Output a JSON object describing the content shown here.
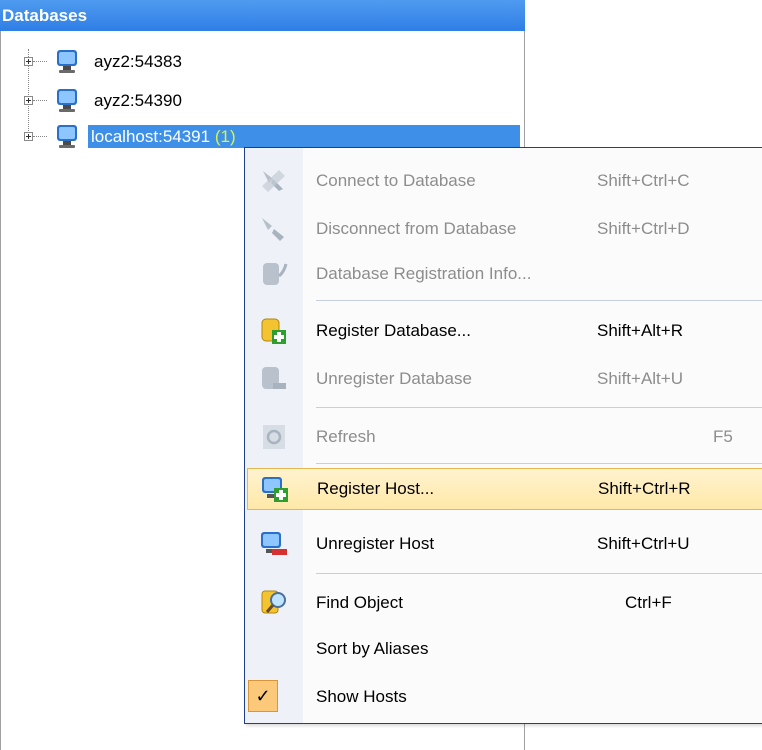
{
  "panel": {
    "title": "Databases",
    "hosts": [
      {
        "label": "ayz2:54383",
        "count": ""
      },
      {
        "label": "ayz2:54390",
        "count": ""
      },
      {
        "label": "localhost:54391",
        "count": "(1)"
      }
    ]
  },
  "menu": {
    "items": [
      {
        "label": "Connect to Database",
        "shortcut": "Shift+Ctrl+C",
        "icon": "connect-icon",
        "enabled": false
      },
      {
        "label": "Disconnect from Database",
        "shortcut": "Shift+Ctrl+D",
        "icon": "disconnect-icon",
        "enabled": false
      },
      {
        "label": "Database Registration Info...",
        "shortcut": "",
        "icon": "database-info-icon",
        "enabled": false
      },
      {
        "label": "Register Database...",
        "shortcut": "Shift+Alt+R",
        "icon": "register-database-icon",
        "enabled": true
      },
      {
        "label": "Unregister Database",
        "shortcut": "Shift+Alt+U",
        "icon": "unregister-database-icon",
        "enabled": false
      },
      {
        "label": "Refresh",
        "shortcut": "F5",
        "icon": "refresh-icon",
        "enabled": false
      },
      {
        "label": "Register Host...",
        "shortcut": "Shift+Ctrl+R",
        "icon": "register-host-icon",
        "enabled": true
      },
      {
        "label": "Unregister Host",
        "shortcut": "Shift+Ctrl+U",
        "icon": "unregister-host-icon",
        "enabled": true
      },
      {
        "label": "Find Object",
        "shortcut": "Ctrl+F",
        "icon": "find-object-icon",
        "enabled": true
      },
      {
        "label": "Sort by Aliases",
        "shortcut": "",
        "icon": "",
        "enabled": true
      },
      {
        "label": "Show Hosts",
        "shortcut": "",
        "icon": "checkmark-icon",
        "enabled": true,
        "checked": true
      }
    ]
  },
  "colors": {
    "header": "#2f7ee6",
    "selection": "#3d8fe8",
    "hover": "#ffe8a8",
    "menu_border": "#1f3f8a"
  }
}
